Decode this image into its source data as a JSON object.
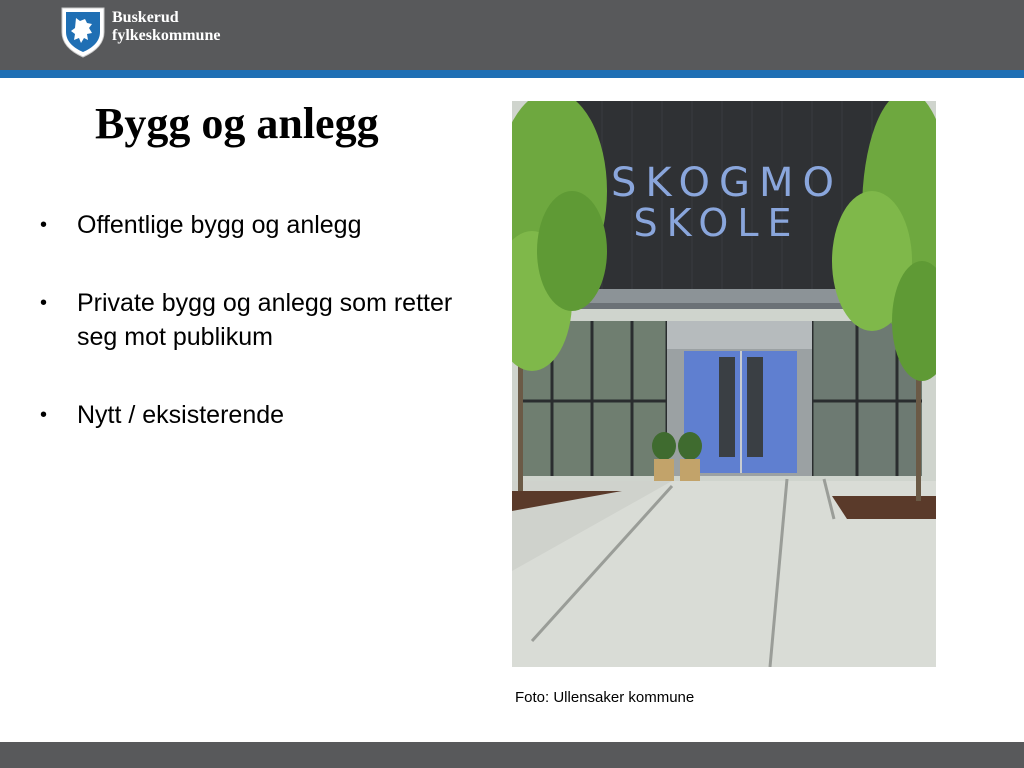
{
  "header": {
    "brand_line1": "Buskerud",
    "brand_line2": "fylkeskommune",
    "bar_color": "#58595b",
    "stripe_color": "#1f6fb4"
  },
  "slide": {
    "title": "Bygg og anlegg",
    "bullets": [
      "Offentlige bygg og anlegg",
      "Private bygg og anlegg som retter seg mot publikum",
      "Nytt / eksisterende"
    ],
    "photo": {
      "sign_line1": "SKOGMO",
      "sign_line2": "SKOLE"
    },
    "caption": "Foto: Ullensaker kommune"
  }
}
